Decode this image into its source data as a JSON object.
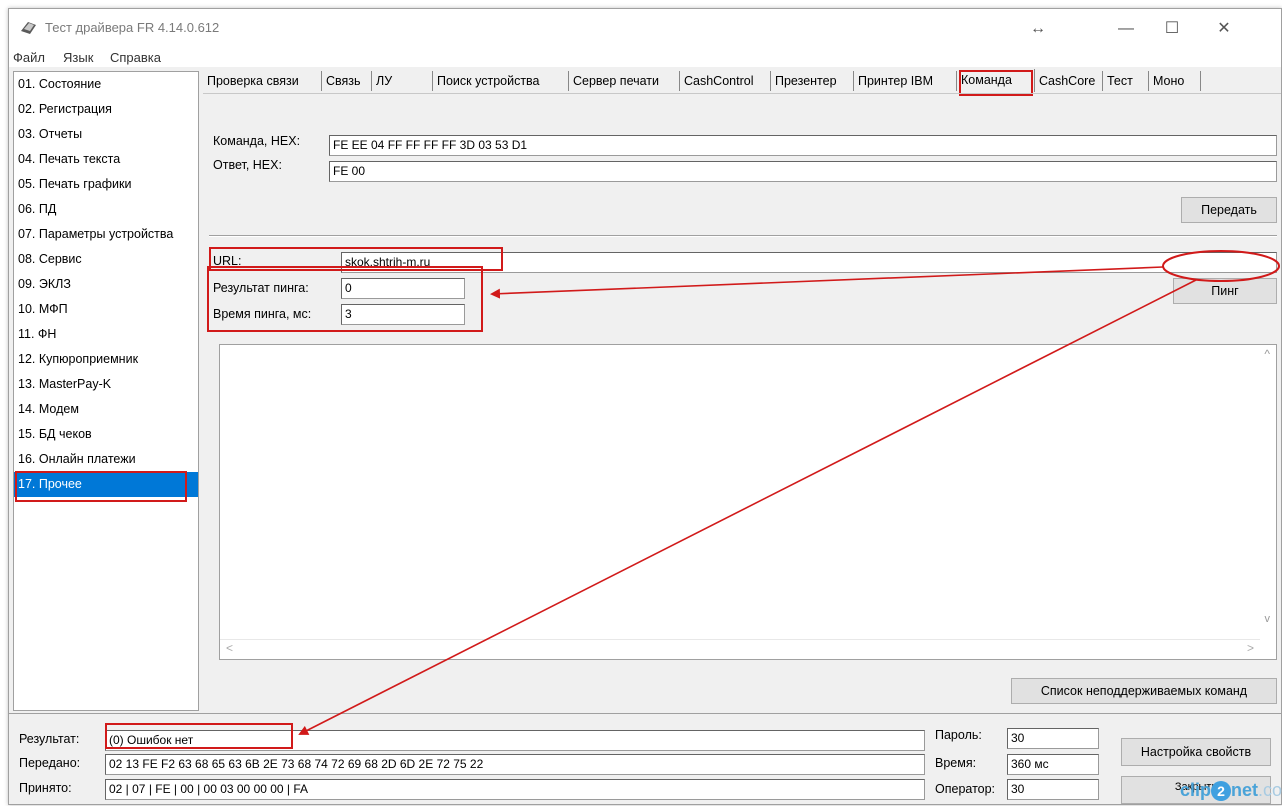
{
  "window": {
    "title": "Тест драйвера FR 4.14.0.612",
    "resize_glyph": "↔",
    "minimize_glyph": "—",
    "maximize_glyph": "☐",
    "close_glyph": "✕"
  },
  "menu": [
    "Файл",
    "Язык",
    "Справка"
  ],
  "sidebar": {
    "selected": "17. Прочее",
    "items": [
      "01. Состояние",
      "02. Регистрация",
      "03. Отчеты",
      "04. Печать текста",
      "05. Печать графики",
      "06. ПД",
      "07. Параметры устройства",
      "08. Сервис",
      "09. ЭКЛЗ",
      "10. МФП",
      "11. ФН",
      "12. Купюроприемник",
      "13. MasterPay-K",
      "14. Модем",
      "15. БД чеков",
      "16. Онлайн платежи",
      "17. Прочее"
    ]
  },
  "tabs": {
    "active": "Команда",
    "items": [
      "Проверка связи",
      "Связь",
      "ЛУ",
      "Поиск устройства",
      "Сервер печати",
      "CashControl",
      "Презентер",
      "Принтер IBM",
      "Команда",
      "CashCore",
      "Тест",
      "Моно"
    ]
  },
  "command": {
    "command_label": "Команда, HEX:",
    "command_value": "FE EE 04 FF FF FF FF 3D 03 53 D1",
    "answer_label": "Ответ, HEX:",
    "answer_value": "FE 00",
    "send_button": "Передать"
  },
  "ping": {
    "url_label": "URL:",
    "url_value": "skok.shtrih-m.ru",
    "result_label": "Результат пинга:",
    "result_value": "0",
    "time_label": "Время пинга, мс:",
    "time_value": "3",
    "ping_button": "Пинг"
  },
  "memo": {
    "scroll_up": "^",
    "scroll_down": "v",
    "scroll_left": "<",
    "scroll_right": ">"
  },
  "unsupported_button": "Список неподдерживаемых команд",
  "status": {
    "result_label": "Результат:",
    "result_value": "(0) Ошибок нет",
    "sent_label": "Передано:",
    "sent_value": "02 13 FE F2 63 68 65 63 6B 2E 73 68 74 72 69 68 2D 6D 2E 72 75 22",
    "received_label": "Принято:",
    "received_value": "02 | 07 | FE | 00 | 00 03 00 00 00 | FA",
    "password_label": "Пароль:",
    "password_value": "30",
    "time_label": "Время:",
    "time_value": "360 мс",
    "operator_label": "Оператор:",
    "operator_value": "30",
    "settings_button": "Настройка свойств",
    "close_button": "Закрыть"
  },
  "watermark": {
    "prefix": "clip",
    "two": "2",
    "suffix": "net",
    "domain": ".com"
  },
  "colors": {
    "selection": "#0078d7",
    "annotation": "#d11a1a",
    "window_bg": "#f0f0f0"
  }
}
